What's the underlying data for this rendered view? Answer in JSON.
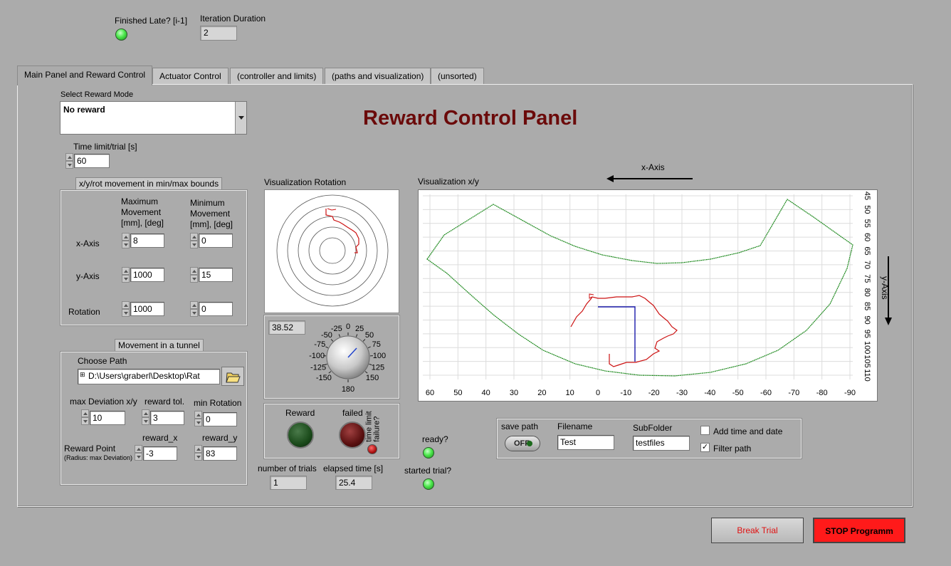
{
  "header": {
    "finished_late_label": "Finished Late? [i-1]",
    "iteration_duration_label": "Iteration Duration",
    "iteration_duration_value": "2"
  },
  "tabs": [
    {
      "label": "Main Panel and Reward Control"
    },
    {
      "label": "Actuator Control"
    },
    {
      "label": "(controller and limits)"
    },
    {
      "label": "(paths and visualization)"
    },
    {
      "label": "(unsorted)"
    }
  ],
  "reward_mode": {
    "label": "Select Reward Mode",
    "value": "No reward"
  },
  "panel_title": "Reward Control Panel",
  "time_limit": {
    "label": "Time limit/trial [s]",
    "value": "60"
  },
  "bounds": {
    "title": "x/y/rot movement in min/max bounds",
    "max_header": "Maximum\nMovement\n[mm], [deg]",
    "min_header": "Minimum\nMovement\n[mm], [deg]",
    "rows": [
      {
        "label": "x-Axis",
        "max": "8",
        "min": "0"
      },
      {
        "label": "y-Axis",
        "max": "1000",
        "min": "15"
      },
      {
        "label": "Rotation",
        "max": "1000",
        "min": "0"
      }
    ]
  },
  "tunnel": {
    "title": "Movement in a tunnel",
    "choose_path_label": "Choose Path",
    "path_value": "D:\\Users\\graberl\\Desktop\\Rat",
    "max_dev_label": "max Deviation x/y",
    "max_dev_value": "10",
    "reward_tol_label": "reward tol.",
    "reward_tol_value": "3",
    "min_rot_label": "min Rotation",
    "min_rot_value": "0",
    "reward_point_label": "Reward Point",
    "reward_point_sub": "(Radius: max Deviation)",
    "reward_x_label": "reward_x",
    "reward_x_value": "-3",
    "reward_y_label": "reward_y",
    "reward_y_value": "83"
  },
  "vis_rotation": {
    "label": "Visualization Rotation",
    "knob_value": "38.52",
    "knob_ticks": [
      "-150",
      "-125",
      "-100",
      "-75",
      "-50",
      "-25",
      "0",
      "25",
      "50",
      "75",
      "100",
      "125",
      "150",
      "180"
    ]
  },
  "indicators": {
    "reward_label": "Reward",
    "failed_label": "failed",
    "time_limit_label": "time limit\nfailure?",
    "num_trials_label": "number of trials",
    "num_trials_value": "1",
    "elapsed_label": "elapsed time [s]",
    "elapsed_value": "25.4",
    "ready_label": "ready?",
    "started_label": "started trial?"
  },
  "vis_xy": {
    "label": "Visualization x/y",
    "x_axis_label": "x-Axis",
    "y_axis_label": "y-Axis",
    "x_ticks": [
      "60",
      "50",
      "40",
      "30",
      "20",
      "10",
      "0",
      "-10",
      "-20",
      "-30",
      "-40",
      "-50",
      "-60",
      "-70",
      "-80",
      "-90"
    ],
    "y_ticks": [
      "45",
      "50",
      "55",
      "60",
      "65",
      "70",
      "75",
      "80",
      "85",
      "90",
      "95",
      "100",
      "105",
      "110"
    ]
  },
  "save": {
    "save_path_label": "save path",
    "toggle_value": "OFF",
    "filename_label": "Filename",
    "filename_value": "Test",
    "subfolder_label": "SubFolder",
    "subfolder_value": "testfiles",
    "add_time_label": "Add time and date",
    "add_time_checked": false,
    "filter_label": "Filter path",
    "filter_checked": true
  },
  "buttons": {
    "break_trial": "Break Trial",
    "stop": "STOP Programm"
  },
  "colors": {
    "title": "#6b0a0a",
    "green_trace": "#1f8a1f",
    "red_trace": "#cc1111",
    "blue_trace": "#1a1aaa",
    "stop_bg": "#ff1a1a",
    "led_green": "#4ce84c"
  }
}
